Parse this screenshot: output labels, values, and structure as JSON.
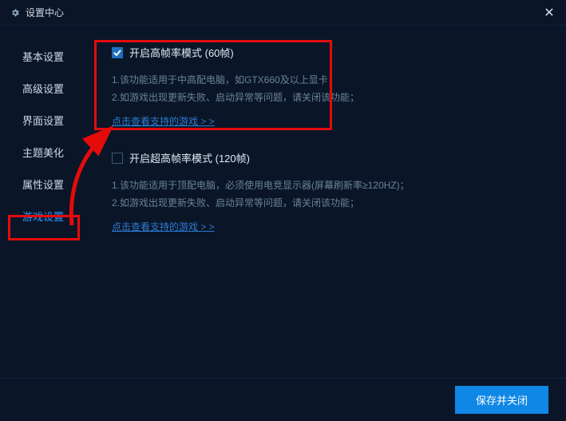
{
  "title": "设置中心",
  "sidebar": {
    "items": [
      {
        "label": "基本设置"
      },
      {
        "label": "高级设置"
      },
      {
        "label": "界面设置"
      },
      {
        "label": "主题美化"
      },
      {
        "label": "属性设置"
      },
      {
        "label": "游戏设置"
      }
    ],
    "activeIndex": 5
  },
  "sections": [
    {
      "checked": true,
      "label": "开启高帧率模式 (60帧)",
      "desc1": "1.该功能适用于中高配电脑，如GTX660及以上显卡；",
      "desc2": "2.如游戏出现更新失败、启动异常等问题，请关闭该功能；",
      "link": "点击查看支持的游戏 > >"
    },
    {
      "checked": false,
      "label": "开启超高帧率模式 (120帧)",
      "desc1": "1.该功能适用于顶配电脑，必须使用电竞显示器(屏幕刷新率≥120HZ)；",
      "desc2": "2.如游戏出现更新失败、启动异常等问题，请关闭该功能；",
      "link": "点击查看支持的游戏 > >"
    }
  ],
  "footer": {
    "save": "保存并关闭"
  }
}
